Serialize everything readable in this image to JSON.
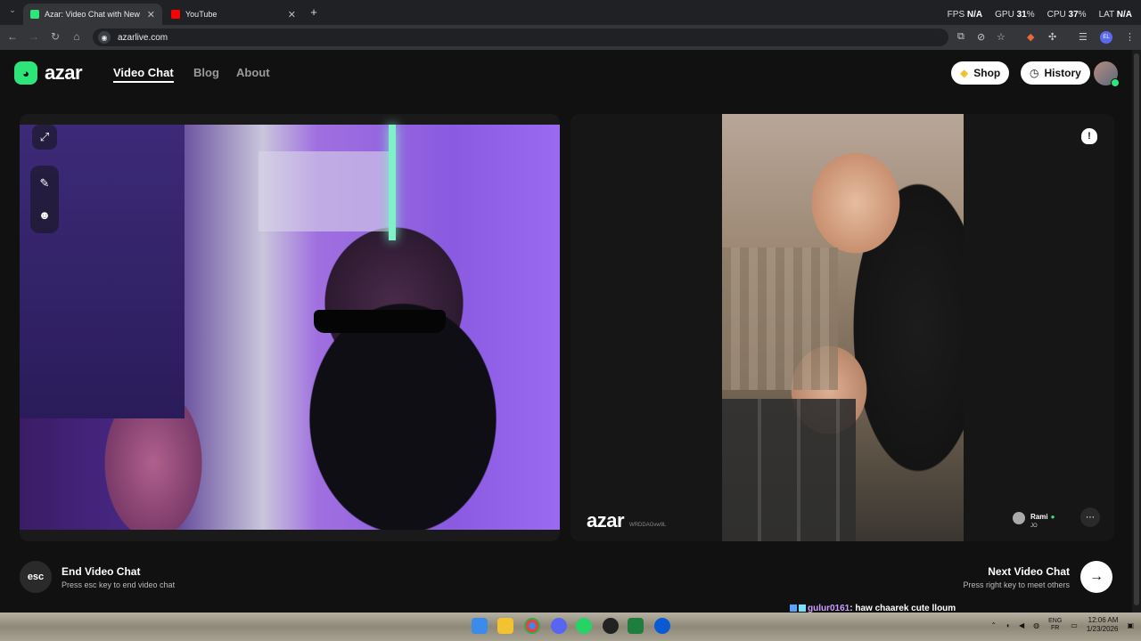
{
  "browser": {
    "tabs": [
      {
        "title": "Azar: Video Chat with New",
        "active": true,
        "favicon_color": "#2ee57a"
      },
      {
        "title": "YouTube",
        "active": false,
        "favicon_color": "#ff0000"
      }
    ],
    "new_tab": "+",
    "url": "azarlive.com",
    "perf": {
      "fps_label": "FPS",
      "fps_value": "N/A",
      "gpu_label": "GPU",
      "gpu_value": "31",
      "cpu_label": "CPU",
      "cpu_value": "37",
      "lat_label": "LAT",
      "lat_value": "N/A",
      "pct": "%"
    }
  },
  "header": {
    "logo_text": "azar",
    "nav": [
      {
        "label": "Video Chat",
        "active": true
      },
      {
        "label": "Blog",
        "active": false
      },
      {
        "label": "About",
        "active": false
      }
    ],
    "shop_label": "Shop",
    "history_label": "History"
  },
  "peer": {
    "name": "Rami",
    "country": "JO",
    "watermark_text": "azar",
    "watermark_id": "WRDDAGvw9L"
  },
  "controls": {
    "esc_key": "esc",
    "end_title": "End Video Chat",
    "end_hint": "Press esc key to end video chat",
    "next_title": "Next Video Chat",
    "next_hint": "Press right key to meet others"
  },
  "stream_chat": {
    "username": "gulur0161",
    "message": ": haw chaarek cute lloum"
  },
  "taskbar": {
    "lang_top": "ENG",
    "lang_bottom": "FR",
    "time": "12:06 AM",
    "date": "1/23/2026"
  },
  "colors": {
    "accent": "#2ee57a",
    "background": "#111111"
  }
}
